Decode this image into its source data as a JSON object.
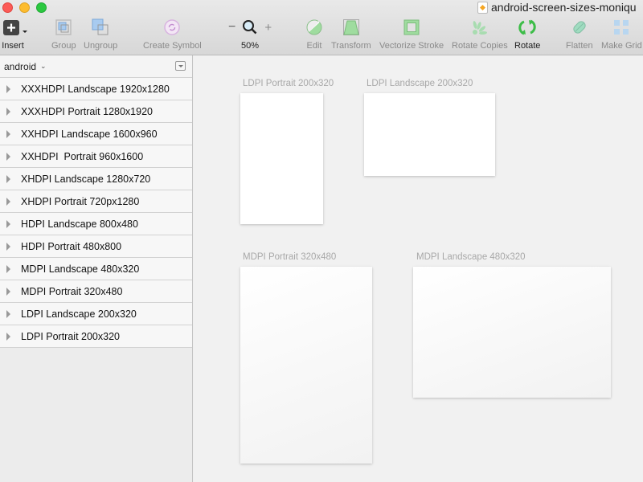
{
  "window": {
    "document_title": "android-screen-sizes-moniqu"
  },
  "toolbar": {
    "insert": "Insert",
    "group": "Group",
    "ungroup": "Ungroup",
    "create_symbol": "Create Symbol",
    "zoom_minus": "−",
    "zoom_plus": "+",
    "zoom_level": "50%",
    "edit": "Edit",
    "transform": "Transform",
    "vectorize_stroke": "Vectorize Stroke",
    "rotate_copies": "Rotate Copies",
    "rotate": "Rotate",
    "flatten": "Flatten",
    "make_grid": "Make Grid"
  },
  "sidebar": {
    "page_name": "android",
    "layers": [
      {
        "label": "XXXHDPI Landscape 1920x1280"
      },
      {
        "label": "XXXHDPI Portrait 1280x1920"
      },
      {
        "label": "XXHDPI Landscape 1600x960"
      },
      {
        "label": "XXHDPI  Portrait 960x1600"
      },
      {
        "label": "XHDPI Landscape 1280x720"
      },
      {
        "label": "XHDPI Portrait 720px1280"
      },
      {
        "label": "HDPI Landscape 800x480"
      },
      {
        "label": "HDPI Portrait 480x800"
      },
      {
        "label": "MDPI Landscape 480x320"
      },
      {
        "label": "MDPI Portrait 320x480"
      },
      {
        "label": "LDPI Landscape 200x320"
      },
      {
        "label": "LDPI Portrait 200x320"
      }
    ]
  },
  "canvas": {
    "artboards": [
      {
        "label": "LDPI Portrait 200x320"
      },
      {
        "label": "LDPI Landscape 200x320"
      },
      {
        "label": "MDPI Portrait 320x480"
      },
      {
        "label": "MDPI Landscape 480x320"
      }
    ]
  }
}
